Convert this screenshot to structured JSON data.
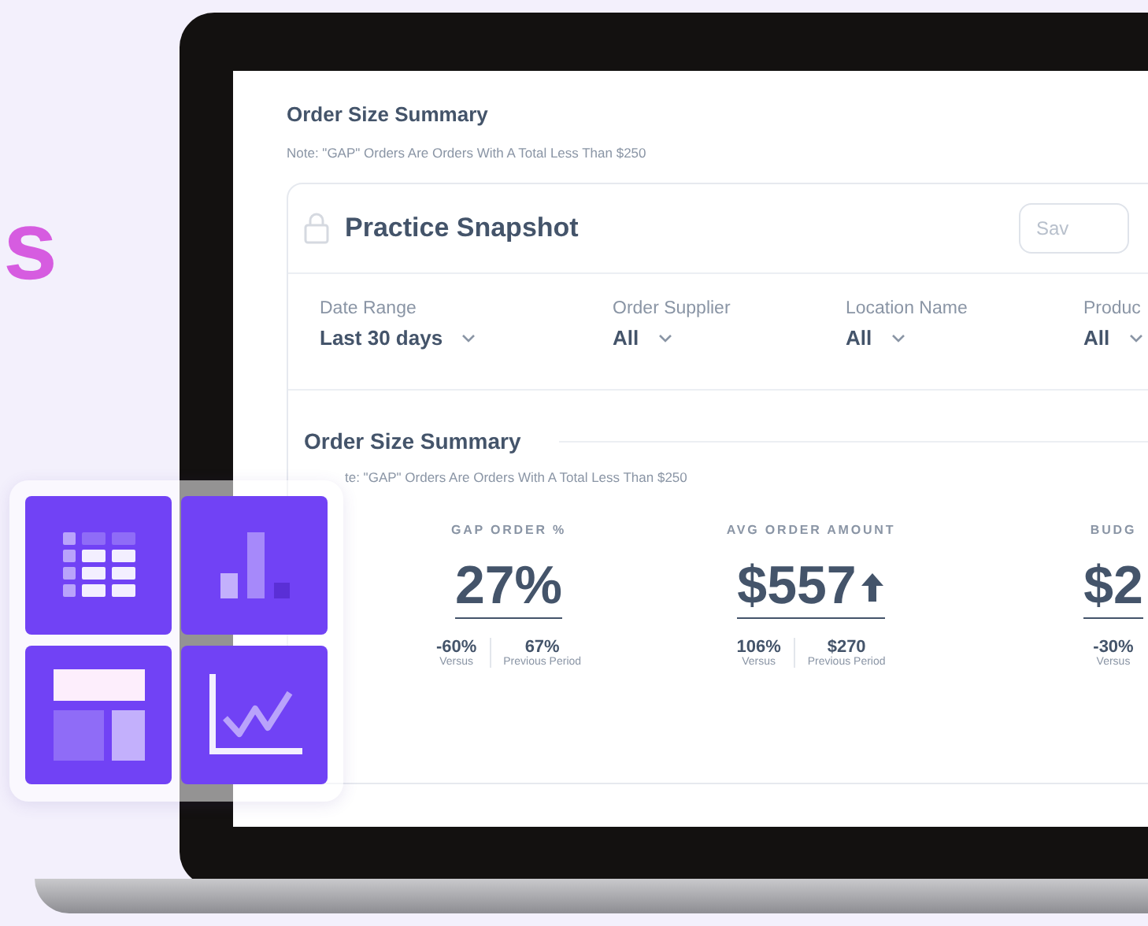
{
  "hero": {
    "heading_fragment": "s"
  },
  "screen": {
    "title": "Order Size Summary",
    "note": "Note: \"GAP\" Orders Are Orders With A Total Less Than $250",
    "card": {
      "title": "Practice Snapshot",
      "save_button": "Sav",
      "filters": [
        {
          "label": "Date Range",
          "value": "Last 30 days"
        },
        {
          "label": "Order Supplier",
          "value": "All"
        },
        {
          "label": "Location Name",
          "value": "All"
        },
        {
          "label": "Produc",
          "value": "All"
        }
      ],
      "section": {
        "title": "Order Size Summary",
        "note": "te: \"GAP\" Orders Are Orders With A Total Less Than $250"
      },
      "metrics": [
        {
          "label": "GAP ORDER %",
          "value": "27%",
          "trend_up": false,
          "change": "-60%",
          "change_caption": "Versus",
          "previous": "67%",
          "previous_caption": "Previous Period"
        },
        {
          "label": "AVG ORDER AMOUNT",
          "value": "$557",
          "trend_up": true,
          "change": "106%",
          "change_caption": "Versus",
          "previous": "$270",
          "previous_caption": "Previous Period"
        },
        {
          "label": "BUDG",
          "value": "$2",
          "trend_up": false,
          "change": "-30%",
          "change_caption": "Versus"
        }
      ]
    }
  },
  "tiles": [
    {
      "kind": "table"
    },
    {
      "kind": "bar"
    },
    {
      "kind": "layout"
    },
    {
      "kind": "line"
    }
  ]
}
